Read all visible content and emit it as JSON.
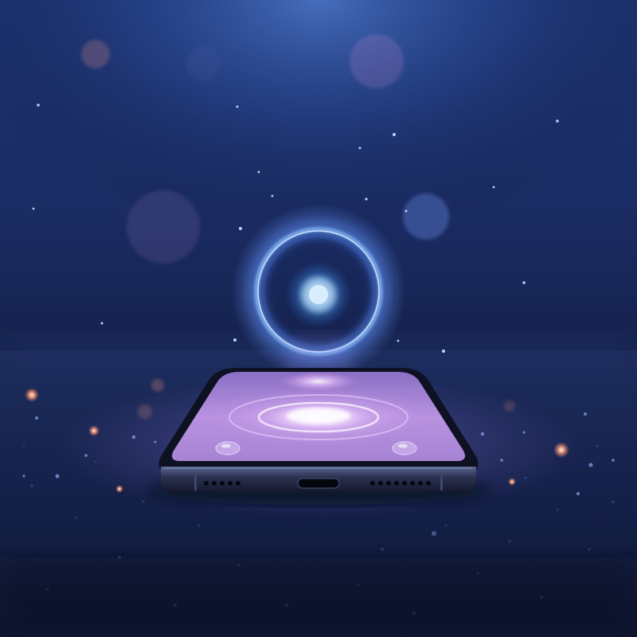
{
  "scene": {
    "subject": "smartphone-lying-face-up",
    "hologram": "glowing-ring-with-bright-core",
    "screen_content": "concentric-glowing-rings",
    "colors": {
      "background_top": "#2a4a8c",
      "background_mid": "#162554",
      "background_bottom": "#0b1229",
      "ground": "#1a2550",
      "ring_glow": "#7fb2ff",
      "core_glow": "#e6f4ff",
      "screen_glow": "#c9a6f0",
      "screen_base": "#b387d6",
      "phone_body": "#1b1f33",
      "particle_warm": "#ff9a7a",
      "particle_cool": "#8fb8ff"
    }
  }
}
